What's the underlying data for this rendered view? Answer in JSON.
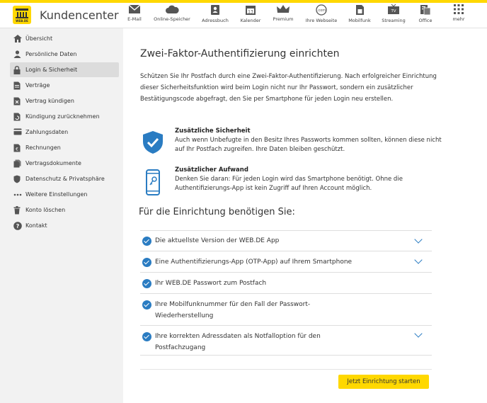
{
  "header": {
    "app_title": "Kundencenter",
    "logo_text": "WEB.DE"
  },
  "nav": [
    {
      "label": "E-Mail",
      "icon": "mail-icon"
    },
    {
      "label": "Online-Speicher",
      "icon": "cloud-icon"
    },
    {
      "label": "Adressbuch",
      "icon": "address-book-icon"
    },
    {
      "label": "Kalender",
      "icon": "calendar-icon",
      "badge": "13"
    },
    {
      "label": "Premium",
      "icon": "crown-icon"
    },
    {
      "label": "Ihre Webseite",
      "icon": "website-icon",
      "badge": ".com"
    },
    {
      "label": "Mobilfunk",
      "icon": "sim-card-icon"
    },
    {
      "label": "Streaming",
      "icon": "tv-icon",
      "badge": "TV"
    },
    {
      "label": "Office",
      "icon": "office-icon"
    },
    {
      "label": "mehr",
      "icon": "grid-icon"
    }
  ],
  "sidebar": {
    "items": [
      {
        "label": "Übersicht",
        "icon": "home-icon",
        "active": false
      },
      {
        "label": "Persönliche Daten",
        "icon": "person-icon",
        "active": false
      },
      {
        "label": "Login & Sicherheit",
        "icon": "lock-icon",
        "active": true
      },
      {
        "label": "Verträge",
        "icon": "document-icon",
        "active": false
      },
      {
        "label": "Vertrag kündigen",
        "icon": "cancel-contract-icon",
        "active": false
      },
      {
        "label": "Kündigung zurücknehmen",
        "icon": "undo-cancel-icon",
        "active": false
      },
      {
        "label": "Zahlungsdaten",
        "icon": "credit-card-icon",
        "active": false
      },
      {
        "label": "Rechnungen",
        "icon": "euro-invoice-icon",
        "active": false
      },
      {
        "label": "Vertragsdokumente",
        "icon": "contract-documents-icon",
        "active": false
      },
      {
        "label": "Datenschutz & Privatsphäre",
        "icon": "shield-icon",
        "active": false
      },
      {
        "label": "Weitere Einstellungen",
        "icon": "dots-icon",
        "active": false
      },
      {
        "label": "Konto löschen",
        "icon": "trash-icon",
        "active": false
      },
      {
        "label": "Kontakt",
        "icon": "help-icon",
        "active": false
      }
    ]
  },
  "main": {
    "title": "Zwei-Faktor-Authentifizierung einrichten",
    "intro": "Schützen Sie Ihr Postfach durch eine Zwei-Faktor-Authentifizierung. Nach erfolgreicher Einrichtung dieser Sicherheitsfunktion wird beim Login nicht nur Ihr Passwort, sondern ein zusätzlicher Bestätigungscode abgefragt, den Sie per Smartphone für jeden Login neu erstellen.",
    "benefits": [
      {
        "title": "Zusätzliche Sicherheit",
        "text": "Auch wenn Unbefugte in den Besitz Ihres Passworts kommen sollten, können diese nicht auf Ihr Postfach zugreifen. Ihre Daten bleiben geschützt.",
        "icon": "shield-check-icon"
      },
      {
        "title": "Zusätzlicher Aufwand",
        "text": "Denken Sie daran: Für jeden Login wird das Smartphone benötigt. Ohne die Authentifizierungs-App ist kein Zugriff auf Ihren Account möglich.",
        "icon": "smartphone-key-icon"
      }
    ],
    "requirements_title": "Für die Einrichtung benötigen Sie:",
    "requirements": [
      {
        "label": "Die aktuellste Version der WEB.DE App",
        "expandable": true
      },
      {
        "label": "Eine Authentifizierungs-App (OTP-App) auf Ihrem Smartphone",
        "expandable": true
      },
      {
        "label": "Ihr WEB.DE Passwort zum Postfach",
        "expandable": false
      },
      {
        "label": "Ihre Mobilfunknummer für den Fall der Passwort-Wiederherstellung",
        "expandable": false
      },
      {
        "label": "Ihre korrekten Adressdaten als Notfalloption für den Postfachzugang",
        "expandable": true
      }
    ],
    "start_button": "Jetzt Einrichtung starten"
  },
  "colors": {
    "brand_yellow": "#ffd800",
    "accent_blue": "#2a7cc2"
  }
}
